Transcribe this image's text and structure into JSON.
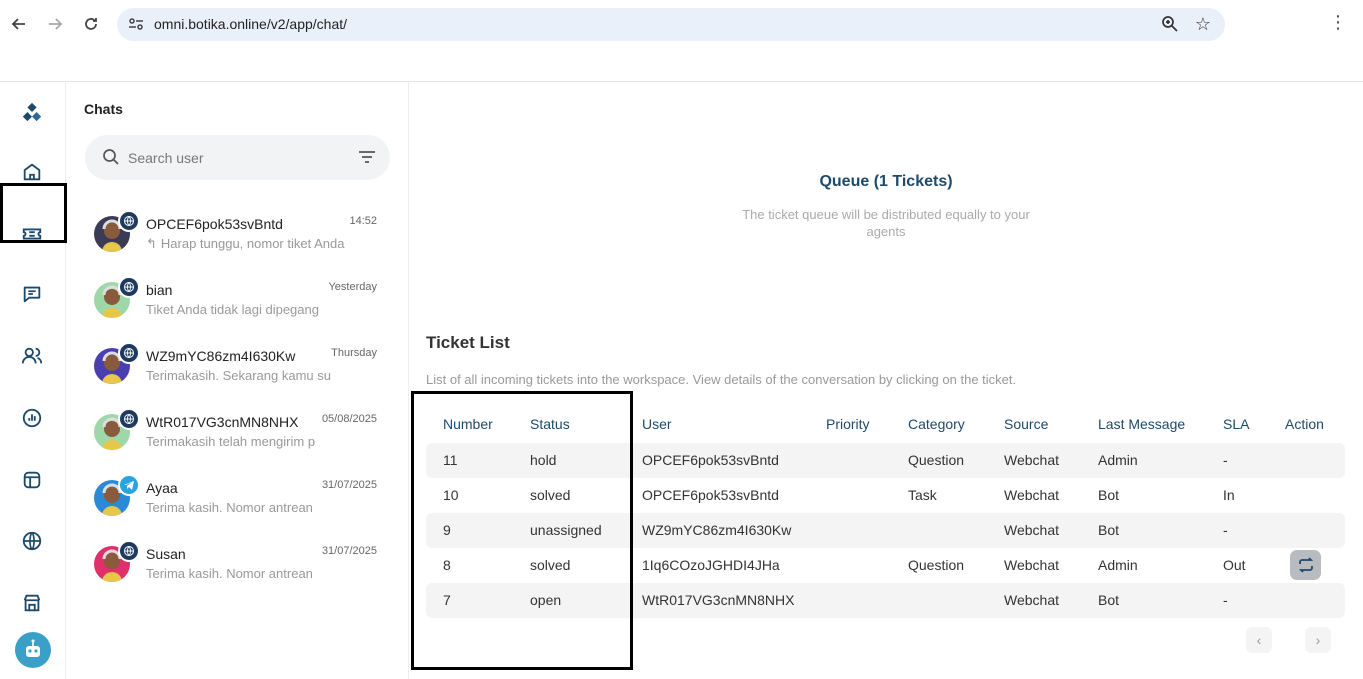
{
  "browser": {
    "url": "omni.botika.online/v2/app/chat/"
  },
  "rail": {
    "items": [
      "logo-icon",
      "home-icon",
      "ticket-icon",
      "chat-icon",
      "contacts-icon",
      "analytics-icon",
      "channels-icon",
      "globe-icon",
      "store-icon"
    ]
  },
  "chats": {
    "title": "Chats",
    "search_placeholder": "Search user",
    "items": [
      {
        "name": "OPCEF6pok53svBntd",
        "time": "14:52",
        "preview": "Harap tunggu, nomor tiket Anda",
        "channel": "web"
      },
      {
        "name": "bian",
        "time": "Yesterday",
        "preview": "Tiket Anda tidak lagi dipegang",
        "channel": "web"
      },
      {
        "name": "WZ9mYC86zm4I630Kw",
        "time": "Thursday",
        "preview": "Terimakasih. Sekarang kamu su",
        "channel": "web"
      },
      {
        "name": "WtR017VG3cnMN8NHX",
        "time": "05/08/2025",
        "preview": "Terimakasih telah mengirim p",
        "channel": "web"
      },
      {
        "name": "Ayaa",
        "time": "31/07/2025",
        "preview": "Terima kasih. Nomor antrean",
        "channel": "telegram"
      },
      {
        "name": "Susan",
        "time": "31/07/2025",
        "preview": "Terima kasih. Nomor antrean",
        "channel": "web"
      }
    ]
  },
  "queue": {
    "title": "Queue (1 Tickets)",
    "description": "The ticket queue will be distributed equally to your agents"
  },
  "ticket_list": {
    "title": "Ticket List",
    "description": "List of all incoming tickets into the workspace. View details of the conversation by clicking on the ticket.",
    "columns": [
      "Number",
      "Status",
      "User",
      "Priority",
      "Category",
      "Source",
      "Last Message",
      "SLA",
      "Action"
    ],
    "rows": [
      {
        "number": "11",
        "status": "hold",
        "user": "OPCEF6pok53svBntd",
        "priority": "",
        "category": "Question",
        "source": "Webchat",
        "last_message": "Admin",
        "sla": "-",
        "action": false
      },
      {
        "number": "10",
        "status": "solved",
        "user": "OPCEF6pok53svBntd",
        "priority": "",
        "category": "Task",
        "source": "Webchat",
        "last_message": "Bot",
        "sla": "In",
        "action": false
      },
      {
        "number": "9",
        "status": "unassigned",
        "user": "WZ9mYC86zm4I630Kw",
        "priority": "",
        "category": "",
        "source": "Webchat",
        "last_message": "Bot",
        "sla": "-",
        "action": false
      },
      {
        "number": "8",
        "status": "solved",
        "user": "1Iq6COzoJGHDI4JHa",
        "priority": "",
        "category": "Question",
        "source": "Webchat",
        "last_message": "Admin",
        "sla": "Out",
        "action": true
      },
      {
        "number": "7",
        "status": "open",
        "user": "WtR017VG3cnMN8NHX",
        "priority": "",
        "category": "",
        "source": "Webchat",
        "last_message": "Bot",
        "sla": "-",
        "action": false
      }
    ]
  },
  "colors": {
    "accent": "#1d4a6b",
    "row_shade": "#f4f4f5",
    "omnibox": "#eaf0fa"
  }
}
